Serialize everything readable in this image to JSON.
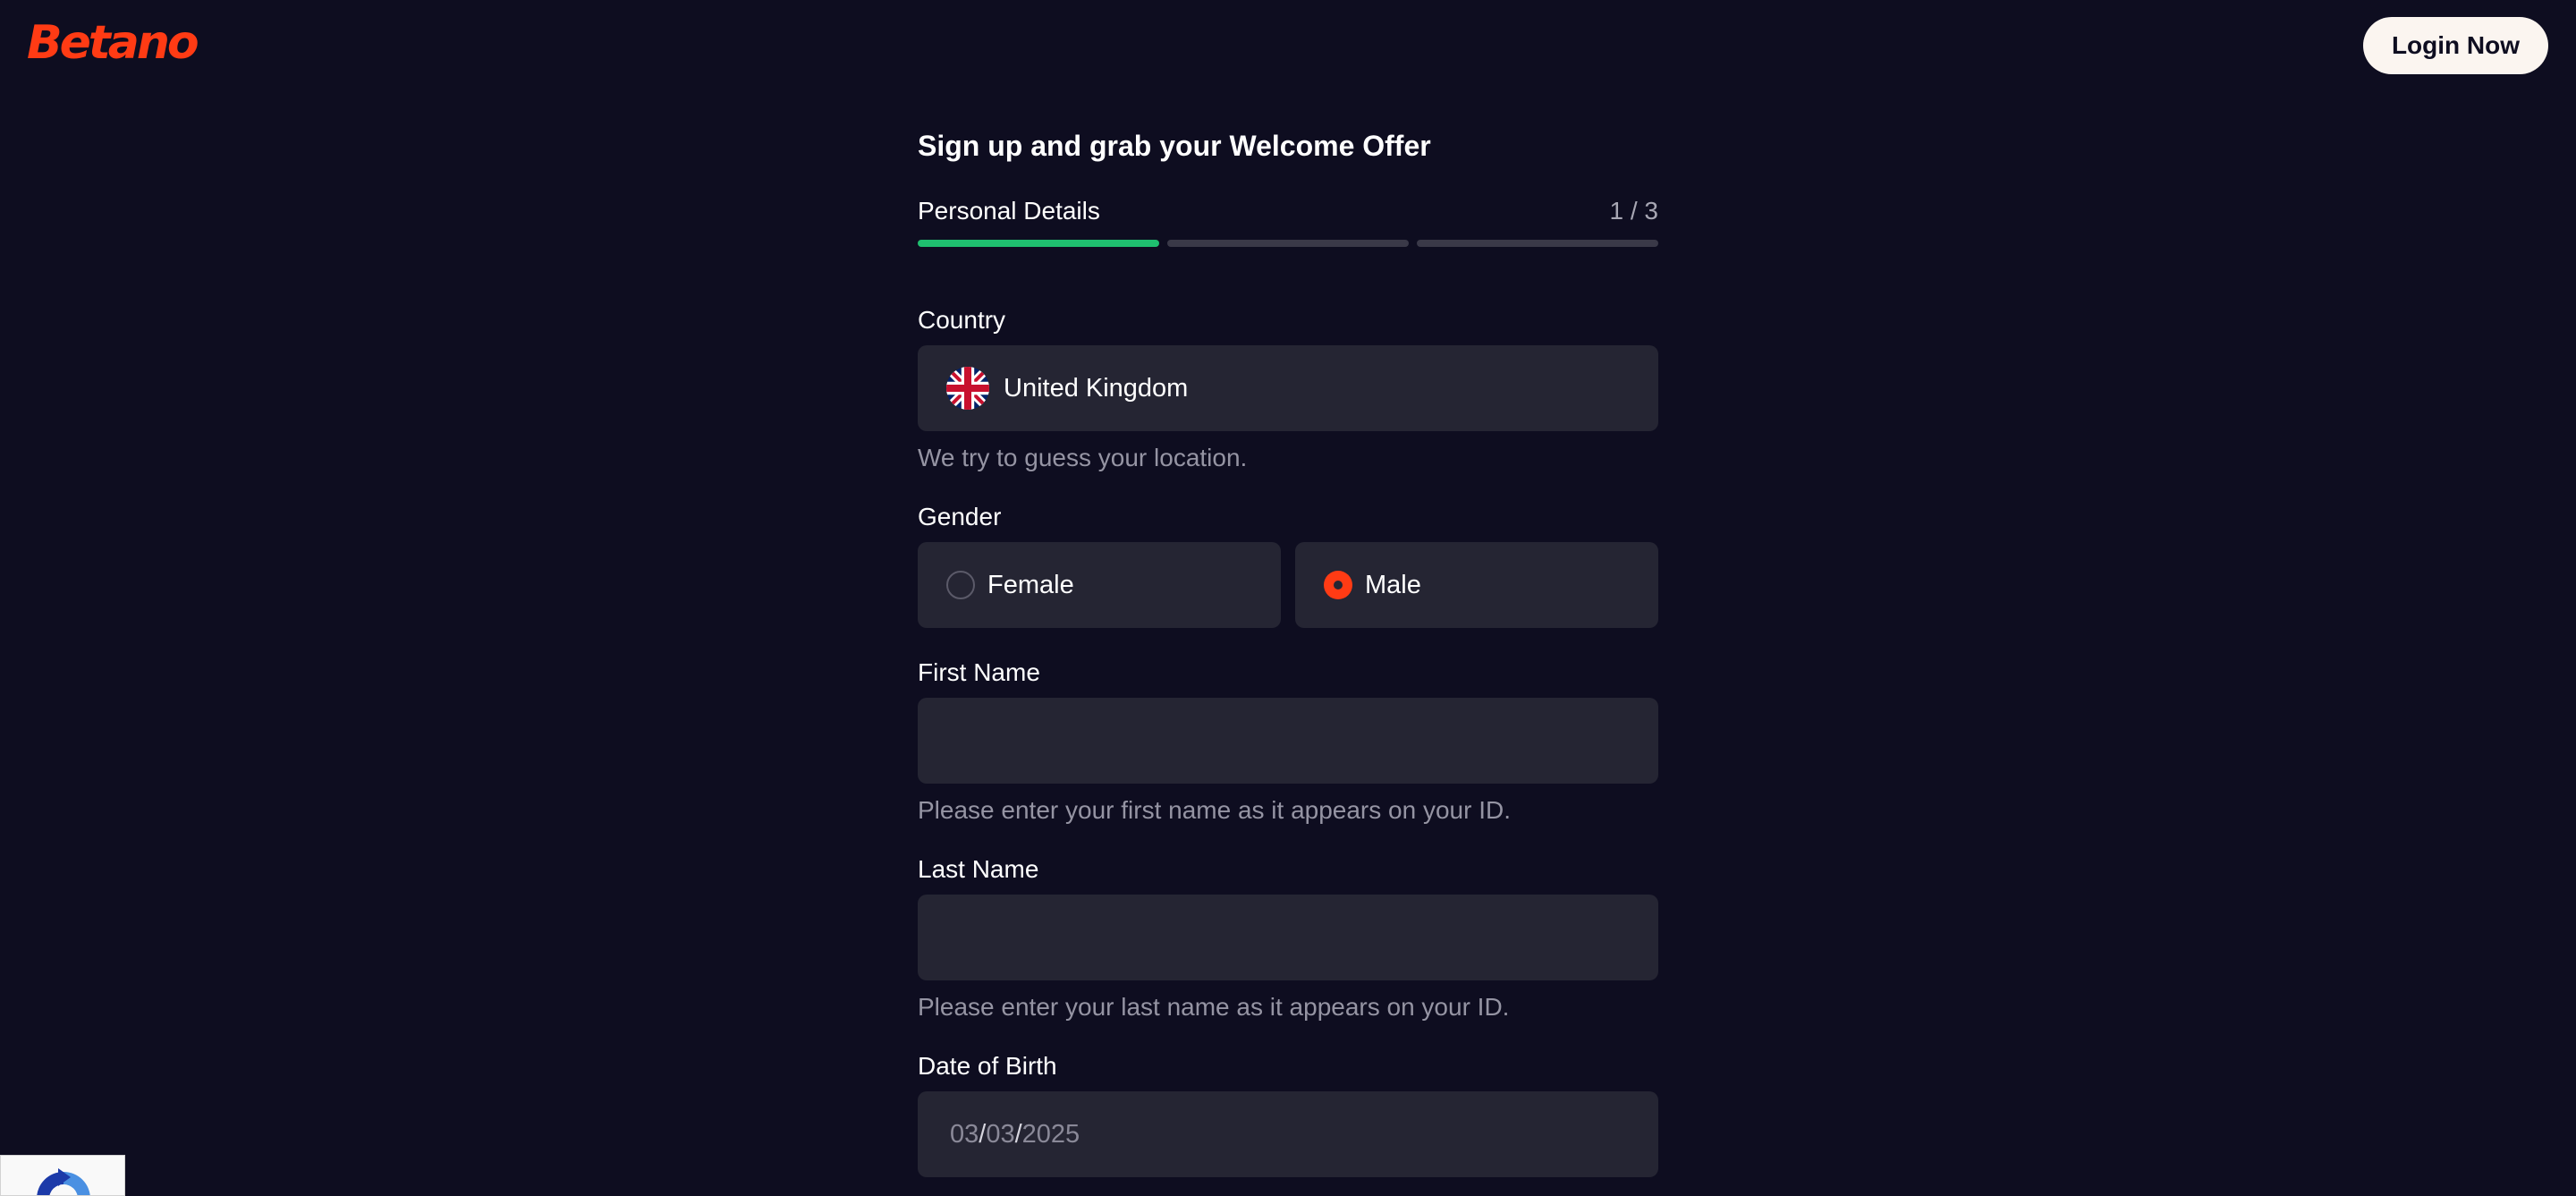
{
  "header": {
    "logo_text": "Betano",
    "login_label": "Login Now"
  },
  "form": {
    "title": "Sign up and grab your Welcome Offer",
    "step": {
      "label": "Personal Details",
      "counter": "1 / 3",
      "completed_segments": 1,
      "total_segments": 3
    },
    "country": {
      "label": "Country",
      "value": "United Kingdom",
      "hint": "We try to guess your location.",
      "flag_icon": "uk-flag-icon"
    },
    "gender": {
      "label": "Gender",
      "options": [
        "Female",
        "Male"
      ],
      "selected": "Male"
    },
    "first_name": {
      "label": "First Name",
      "value": "",
      "hint": "Please enter your first name as it appears on your ID."
    },
    "last_name": {
      "label": "Last Name",
      "value": "",
      "hint": "Please enter your last name as it appears on your ID."
    },
    "dob": {
      "label": "Date of Birth",
      "day": "03",
      "month": "03",
      "year": "2025",
      "separator": "/"
    }
  },
  "colors": {
    "background": "#0e0d20",
    "brand": "#ff3b14",
    "field_bg": "#252533",
    "progress_done": "#1fbf6f",
    "progress_todo": "#3a3948"
  }
}
